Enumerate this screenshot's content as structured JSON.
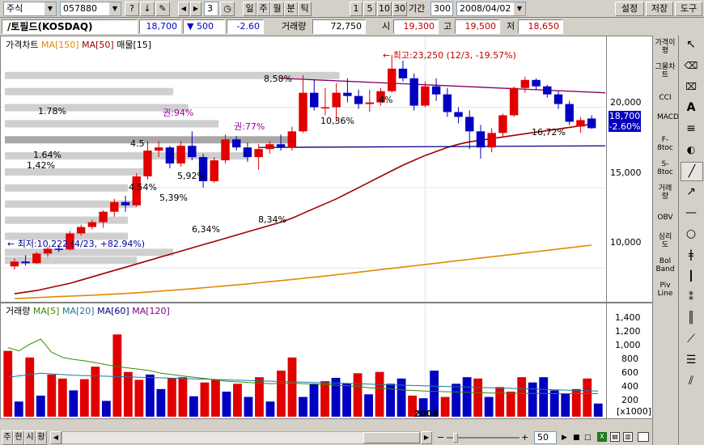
{
  "toolbar": {
    "market_select": "주식",
    "code_value": "057880",
    "periods": [
      "1",
      "5",
      "10",
      "30"
    ],
    "interval_label": "기간",
    "interval_value": "300",
    "date_value": "2008/04/02",
    "tick_value": "3",
    "timeframes": [
      "일",
      "주",
      "월",
      "분",
      "틱"
    ],
    "menu": [
      "설정",
      "저장",
      "도구"
    ]
  },
  "quote": {
    "name": "/토필드(KOSDAQ)",
    "price": "18,700",
    "change": "▼ 500",
    "change_pct": "-2.60",
    "volume_label": "거래량",
    "volume": "72,750",
    "open_label": "시",
    "open": "19,300",
    "high_label": "고",
    "high": "19,500",
    "low_label": "저",
    "low": "18,650"
  },
  "price_chart": {
    "legend": [
      {
        "text": "가격차트",
        "color": "#000000"
      },
      {
        "text": "MA[150]",
        "color": "#e08a00"
      },
      {
        "text": "MA[50]",
        "color": "#a00000"
      },
      {
        "text": "매물[15]",
        "color": "#000000"
      }
    ],
    "y_ticks": [
      "20,000",
      "15,000",
      "10,000"
    ],
    "last_price": "18,700",
    "last_pct": "-2.60%",
    "annotations": {
      "high": "← 최고:23,250 (12/3, -19.57%)",
      "low": "← 최저:10,222 (4/23, +82.94%)"
    },
    "profile_labels": [
      "8,58%",
      "1.78%",
      "10,36%",
      "1.64%",
      "1,42%",
      "5,92%",
      "4.54%",
      "5,39%",
      "8,34%",
      "6,34%",
      "16,72%",
      "4.5",
      "4%"
    ],
    "rights_labels": [
      "권:94%",
      "권:77%"
    ]
  },
  "volume_chart": {
    "legend": [
      {
        "text": "거래량",
        "color": "#000000"
      },
      {
        "text": "MA[5]",
        "color": "#3a8a00"
      },
      {
        "text": "MA[20]",
        "color": "#1a7aa0"
      },
      {
        "text": "MA[60]",
        "color": "#000080"
      },
      {
        "text": "MA[120]",
        "color": "#800080"
      }
    ],
    "y_ticks": [
      "1,400",
      "1,200",
      "1,000",
      "800",
      "600",
      "400",
      "200"
    ],
    "unit": "[x1000]",
    "x_label": "2008"
  },
  "bottom": {
    "tabs": [
      "주",
      "현",
      "시",
      "황"
    ],
    "zoom_value": "50"
  },
  "right_panel": {
    "items": [
      "가격이평",
      "그물차트",
      "CCI",
      "MACD",
      "F-8toc",
      "S-8toc",
      "거래량",
      "OBV",
      "심리도",
      "Bol Band",
      "Piv Line"
    ]
  },
  "chart_data": [
    {
      "type": "candlestick",
      "title": "",
      "ylabel": "",
      "ylim": [
        8000,
        23500
      ],
      "candles": [
        {
          "o": 10100,
          "h": 10600,
          "l": 9900,
          "c": 10400
        },
        {
          "o": 10400,
          "h": 10800,
          "l": 10150,
          "c": 10300
        },
        {
          "o": 10300,
          "h": 11000,
          "l": 10250,
          "c": 10900
        },
        {
          "o": 10900,
          "h": 11300,
          "l": 10700,
          "c": 11200
        },
        {
          "o": 11200,
          "h": 11400,
          "l": 11000,
          "c": 11150
        },
        {
          "o": 11150,
          "h": 12300,
          "l": 11100,
          "c": 12150
        },
        {
          "o": 12150,
          "h": 12700,
          "l": 12000,
          "c": 12550
        },
        {
          "o": 12550,
          "h": 13000,
          "l": 12400,
          "c": 12850
        },
        {
          "o": 12850,
          "h": 13600,
          "l": 12500,
          "c": 13500
        },
        {
          "o": 13500,
          "h": 14300,
          "l": 13200,
          "c": 14100
        },
        {
          "o": 14100,
          "h": 14500,
          "l": 13500,
          "c": 13900
        },
        {
          "o": 13900,
          "h": 15900,
          "l": 13800,
          "c": 15700
        },
        {
          "o": 15700,
          "h": 17900,
          "l": 15500,
          "c": 17300
        },
        {
          "o": 17300,
          "h": 17900,
          "l": 16900,
          "c": 17500
        },
        {
          "o": 17500,
          "h": 17600,
          "l": 16200,
          "c": 16500
        },
        {
          "o": 16500,
          "h": 17900,
          "l": 16300,
          "c": 17600
        },
        {
          "o": 17600,
          "h": 18500,
          "l": 16700,
          "c": 16900
        },
        {
          "o": 16900,
          "h": 17100,
          "l": 15000,
          "c": 15400
        },
        {
          "o": 15400,
          "h": 16900,
          "l": 15300,
          "c": 16700
        },
        {
          "o": 16700,
          "h": 18300,
          "l": 16500,
          "c": 18000
        },
        {
          "o": 18000,
          "h": 18200,
          "l": 17300,
          "c": 17500
        },
        {
          "o": 17500,
          "h": 17800,
          "l": 16600,
          "c": 16900
        },
        {
          "o": 16900,
          "h": 17700,
          "l": 16100,
          "c": 17400
        },
        {
          "o": 17400,
          "h": 17900,
          "l": 17100,
          "c": 17700
        },
        {
          "o": 17700,
          "h": 18300,
          "l": 17300,
          "c": 17500
        },
        {
          "o": 17500,
          "h": 18800,
          "l": 17300,
          "c": 18500
        },
        {
          "o": 18500,
          "h": 22000,
          "l": 18400,
          "c": 20900
        },
        {
          "o": 20900,
          "h": 21700,
          "l": 19800,
          "c": 20000
        },
        {
          "o": 20000,
          "h": 21200,
          "l": 19500,
          "c": 20000
        },
        {
          "o": 20000,
          "h": 21500,
          "l": 19100,
          "c": 20900
        },
        {
          "o": 20900,
          "h": 21800,
          "l": 20300,
          "c": 20700
        },
        {
          "o": 20700,
          "h": 21100,
          "l": 19900,
          "c": 20200
        },
        {
          "o": 20200,
          "h": 21100,
          "l": 19700,
          "c": 20300
        },
        {
          "o": 20300,
          "h": 21200,
          "l": 20100,
          "c": 21000
        },
        {
          "o": 21000,
          "h": 23250,
          "l": 20900,
          "c": 22400
        },
        {
          "o": 22400,
          "h": 22900,
          "l": 21600,
          "c": 21800
        },
        {
          "o": 21800,
          "h": 22100,
          "l": 19800,
          "c": 20100
        },
        {
          "o": 20100,
          "h": 21600,
          "l": 20000,
          "c": 21300
        },
        {
          "o": 21300,
          "h": 21800,
          "l": 20400,
          "c": 20800
        },
        {
          "o": 20800,
          "h": 21200,
          "l": 19400,
          "c": 19700
        },
        {
          "o": 19700,
          "h": 20000,
          "l": 19000,
          "c": 19400
        },
        {
          "o": 19400,
          "h": 19800,
          "l": 17400,
          "c": 18500
        },
        {
          "o": 18500,
          "h": 18900,
          "l": 16800,
          "c": 17500
        },
        {
          "o": 17500,
          "h": 18700,
          "l": 17200,
          "c": 18400
        },
        {
          "o": 18400,
          "h": 19600,
          "l": 18200,
          "c": 19500
        },
        {
          "o": 19500,
          "h": 21300,
          "l": 19400,
          "c": 21200
        },
        {
          "o": 21200,
          "h": 21900,
          "l": 20900,
          "c": 21700
        },
        {
          "o": 21700,
          "h": 21800,
          "l": 21100,
          "c": 21300
        },
        {
          "o": 21300,
          "h": 21400,
          "l": 20600,
          "c": 20800
        },
        {
          "o": 20800,
          "h": 21000,
          "l": 19900,
          "c": 20200
        },
        {
          "o": 20200,
          "h": 20400,
          "l": 18900,
          "c": 19100
        },
        {
          "o": 18800,
          "h": 19400,
          "l": 18400,
          "c": 19200
        },
        {
          "o": 19300,
          "h": 19500,
          "l": 18650,
          "c": 18700
        }
      ],
      "ma50": [
        8400,
        8500,
        8600,
        8750,
        8900,
        9050,
        9250,
        9450,
        9650,
        9850,
        10050,
        10250,
        10450,
        10650,
        10850,
        11050,
        11250,
        11450,
        11650,
        11850,
        12050,
        12250,
        12450,
        12650,
        12850,
        13100,
        13400,
        13700,
        14000,
        14300,
        14650,
        15000,
        15350,
        15700,
        16050,
        16400,
        16700,
        17000,
        17250,
        17500,
        17700,
        17850,
        17950,
        18050,
        18150,
        18250,
        18350,
        18450,
        18550,
        18650,
        18750,
        18850,
        18950
      ],
      "ma150": [
        8100,
        8130,
        8160,
        8190,
        8220,
        8250,
        8280,
        8310,
        8340,
        8380,
        8420,
        8460,
        8510,
        8560,
        8610,
        8660,
        8710,
        8770,
        8830,
        8890,
        8950,
        9010,
        9080,
        9150,
        9220,
        9290,
        9360,
        9430,
        9500,
        9580,
        9660,
        9740,
        9820,
        9900,
        9980,
        10060,
        10140,
        10220,
        10300,
        10380,
        10460,
        10540,
        10620,
        10700,
        10780,
        10860,
        10940,
        11020,
        11100,
        11180,
        11260,
        11340,
        11420
      ]
    },
    {
      "type": "bar",
      "title": "",
      "ylabel": "",
      "ylim": [
        0,
        1500
      ],
      "values": [
        1000,
        230,
        900,
        320,
        640,
        580,
        400,
        570,
        760,
        240,
        1250,
        680,
        560,
        640,
        420,
        590,
        600,
        310,
        520,
        560,
        380,
        500,
        300,
        600,
        230,
        700,
        900,
        300,
        500,
        540,
        590,
        510,
        660,
        340,
        680,
        500,
        580,
        320,
        280,
        700,
        300,
        500,
        600,
        580,
        300,
        450,
        380,
        600,
        520,
        600,
        400,
        350,
        420,
        580,
        200
      ],
      "red": [
        true,
        false,
        true,
        false,
        true,
        true,
        false,
        true,
        true,
        false,
        true,
        true,
        true,
        false,
        false,
        true,
        true,
        false,
        true,
        true,
        false,
        true,
        false,
        true,
        false,
        true,
        true,
        false,
        false,
        true,
        false,
        false,
        true,
        false,
        true,
        false,
        false,
        true,
        false,
        false,
        true,
        false,
        false,
        true,
        false,
        true,
        true,
        true,
        false,
        false,
        false,
        false,
        true,
        true,
        false
      ],
      "ma5": [
        1050,
        1000,
        1100,
        1180,
        980,
        900,
        870,
        850,
        820,
        790,
        760,
        740,
        720,
        700,
        660,
        640,
        620,
        600,
        580,
        560,
        540,
        530,
        520,
        510,
        500,
        505,
        510,
        500,
        495,
        490,
        480,
        470,
        460,
        440,
        430,
        420,
        410,
        400,
        390,
        385,
        380,
        375,
        370,
        365,
        360,
        358,
        356,
        355,
        354,
        353,
        352,
        351,
        350,
        350,
        350
      ],
      "ma20": [
        600,
        620,
        640,
        660,
        650,
        640,
        630,
        625,
        620,
        615,
        610,
        605,
        600,
        595,
        590,
        585,
        580,
        575,
        570,
        565,
        560,
        555,
        550,
        545,
        540,
        535,
        530,
        525,
        520,
        515,
        510,
        505,
        500,
        495,
        490,
        485,
        480,
        475,
        470,
        465,
        460,
        455,
        450,
        445,
        440,
        435,
        430,
        425,
        420,
        415,
        410,
        405,
        400,
        395,
        390
      ]
    }
  ]
}
